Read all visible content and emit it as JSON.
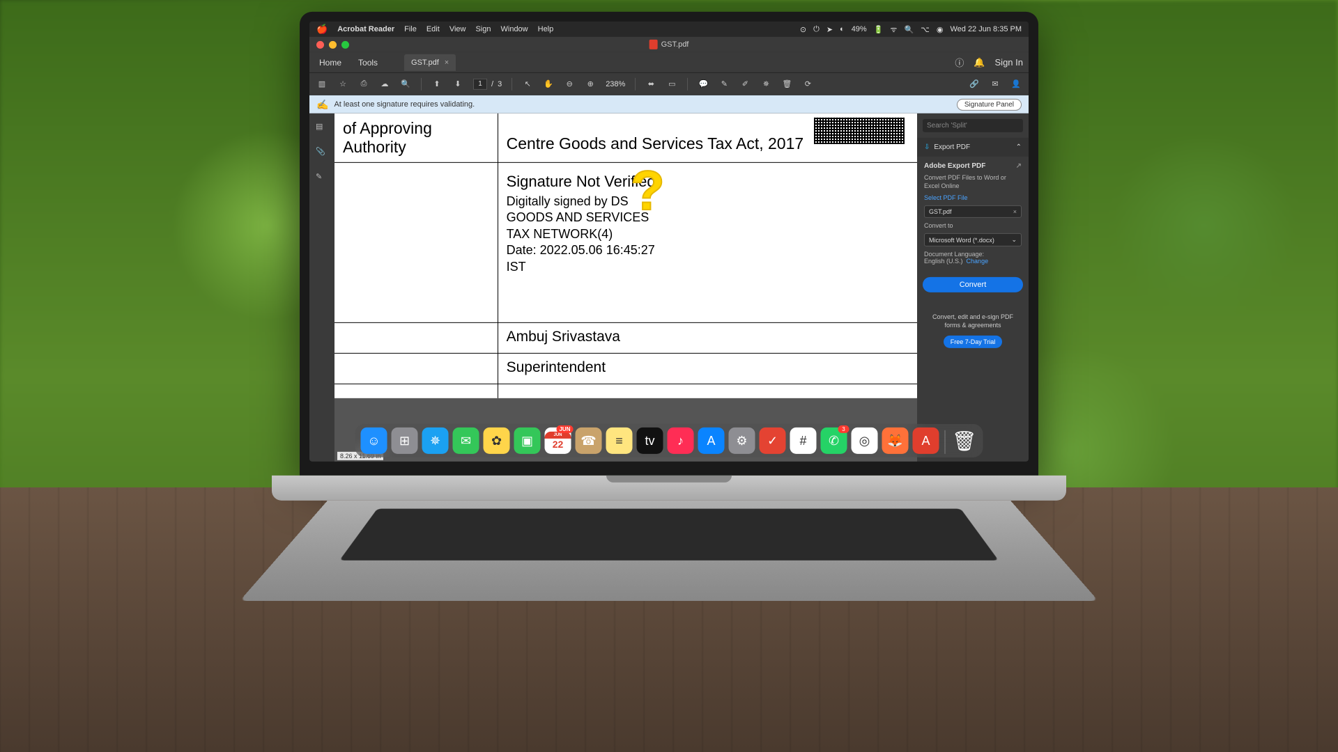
{
  "menubar": {
    "app_name": "Acrobat Reader",
    "items": [
      "File",
      "Edit",
      "View",
      "Sign",
      "Window",
      "Help"
    ],
    "battery": "49%",
    "datetime": "Wed 22 Jun  8:35 PM"
  },
  "window": {
    "title": "GST.pdf"
  },
  "tabs": {
    "home": "Home",
    "tools": "Tools",
    "doc_tab": "GST.pdf",
    "sign_in": "Sign In"
  },
  "toolbar": {
    "page_current": "1",
    "page_total": "3",
    "zoom": "238%"
  },
  "sig_banner": {
    "message": "At least one signature requires validating.",
    "button": "Signature Panel"
  },
  "document": {
    "hdr_left": "of Approving Authority",
    "hdr_right": "Centre Goods and Services Tax Act, 2017",
    "sig_title": "Signature Not Verified",
    "sig_line1": "Digitally signed by DS",
    "sig_line2": "GOODS AND SERVICES",
    "sig_line3": "TAX NETWORK(4)",
    "sig_line4": "Date: 2022.05.06 16:45:27",
    "sig_line5": "IST",
    "row_name": "Ambuj Srivastava",
    "row_designation": "Superintendent",
    "dimensions": "8.26 x 11.69 in"
  },
  "right_panel": {
    "search_placeholder": "Search 'Split'",
    "export_title": "Export PDF",
    "adobe_title": "Adobe Export PDF",
    "adobe_desc": "Convert PDF Files to Word or Excel Online",
    "select_label": "Select PDF File",
    "selected_file": "GST.pdf",
    "convert_to_label": "Convert to",
    "convert_to_value": "Microsoft Word (*.docx)",
    "lang_label": "Document Language:",
    "lang_value": "English (U.S.)",
    "lang_change": "Change",
    "convert_btn": "Convert",
    "promo_text": "Convert, edit and e-sign PDF forms & agreements",
    "trial_btn": "Free 7-Day Trial"
  },
  "dock": {
    "apps": [
      {
        "name": "finder",
        "color": "#1e90ff",
        "glyph": "☺"
      },
      {
        "name": "launchpad",
        "color": "#8e8e93",
        "glyph": "⊞"
      },
      {
        "name": "safari",
        "color": "#1ba1f2",
        "glyph": "✵"
      },
      {
        "name": "messages",
        "color": "#34c759",
        "glyph": "✉"
      },
      {
        "name": "photos",
        "color": "#ffd54a",
        "glyph": "✿"
      },
      {
        "name": "facetime",
        "color": "#34c759",
        "glyph": "▣"
      },
      {
        "name": "calendar",
        "color": "#fff",
        "glyph": "22",
        "badge": "JUN"
      },
      {
        "name": "contacts",
        "color": "#c9a36b",
        "glyph": "☎"
      },
      {
        "name": "notes",
        "color": "#ffe57f",
        "glyph": "≡"
      },
      {
        "name": "appletv",
        "color": "#111",
        "glyph": "tv"
      },
      {
        "name": "music",
        "color": "#ff2d55",
        "glyph": "♪"
      },
      {
        "name": "appstore",
        "color": "#0a84ff",
        "glyph": "A"
      },
      {
        "name": "settings",
        "color": "#8e8e93",
        "glyph": "⚙"
      },
      {
        "name": "todoist",
        "color": "#e44332",
        "glyph": "✓"
      },
      {
        "name": "slack",
        "color": "#fff",
        "glyph": "#"
      },
      {
        "name": "whatsapp",
        "color": "#25d366",
        "glyph": "✆",
        "badge": "3"
      },
      {
        "name": "chrome",
        "color": "#fff",
        "glyph": "◎"
      },
      {
        "name": "firefox",
        "color": "#ff7139",
        "glyph": "🦊"
      },
      {
        "name": "acrobat",
        "color": "#e03e2d",
        "glyph": "A"
      }
    ],
    "trash": {
      "name": "trash",
      "glyph": "🗑"
    }
  }
}
